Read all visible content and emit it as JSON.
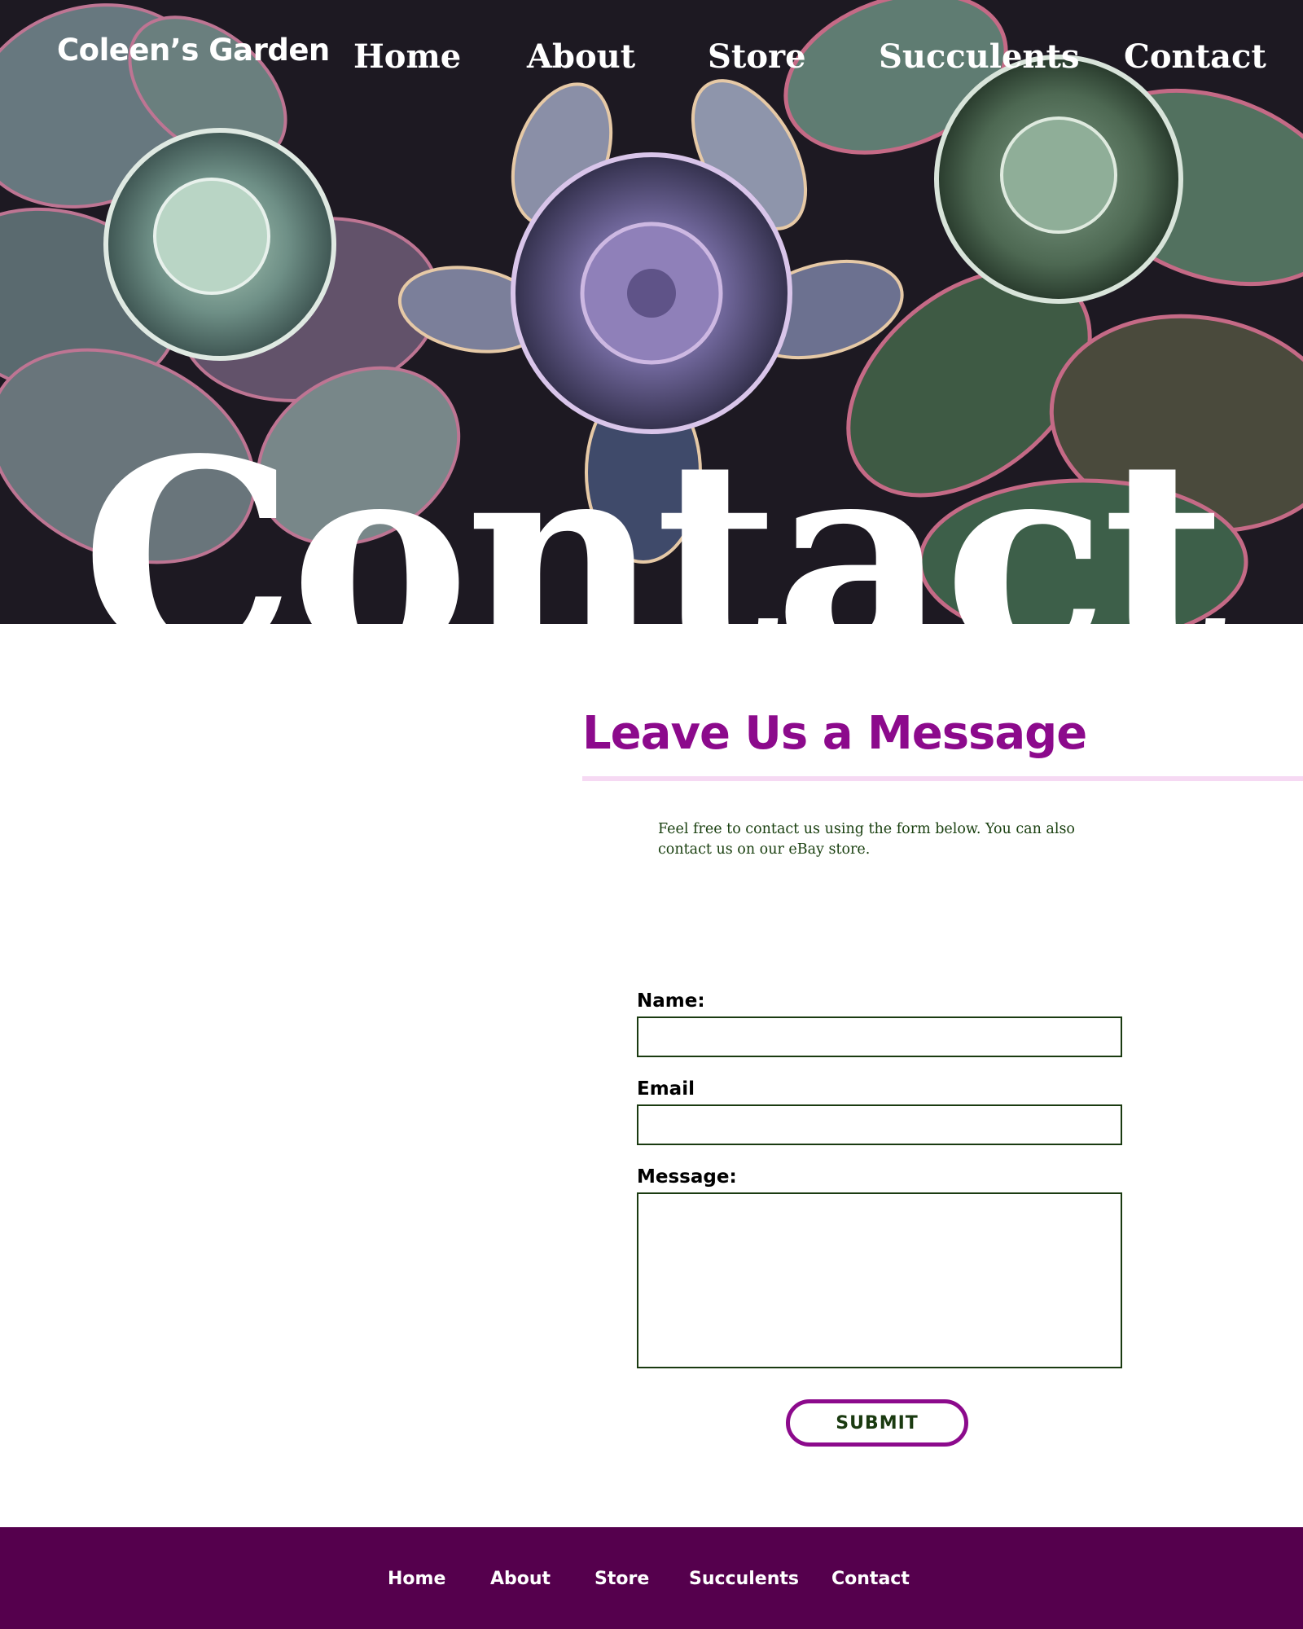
{
  "brand": {
    "name": "Coleen’s Garden"
  },
  "nav": {
    "items": [
      {
        "label": "Home"
      },
      {
        "label": "About"
      },
      {
        "label": "Store"
      },
      {
        "label": "Succulents"
      },
      {
        "label": "Contact"
      }
    ]
  },
  "hero": {
    "title": "Contact"
  },
  "contact": {
    "heading": "Leave Us a Message",
    "intro": "Feel free to contact us using the form below. You can also contact us on our eBay store.",
    "name_label": "Name:",
    "name_value": "",
    "email_label": "Email",
    "email_value": "",
    "message_label": "Message:",
    "message_value": "",
    "submit_label": "SUBMIT"
  },
  "footer": {
    "items": [
      {
        "label": "Home"
      },
      {
        "label": "About"
      },
      {
        "label": "Store"
      },
      {
        "label": "Succulents"
      },
      {
        "label": "Contact"
      }
    ]
  },
  "colors": {
    "accent": "#8c0a8c",
    "rule": "#f6d9f3",
    "text_green": "#1a3a10",
    "footer_bg": "#55004d"
  }
}
